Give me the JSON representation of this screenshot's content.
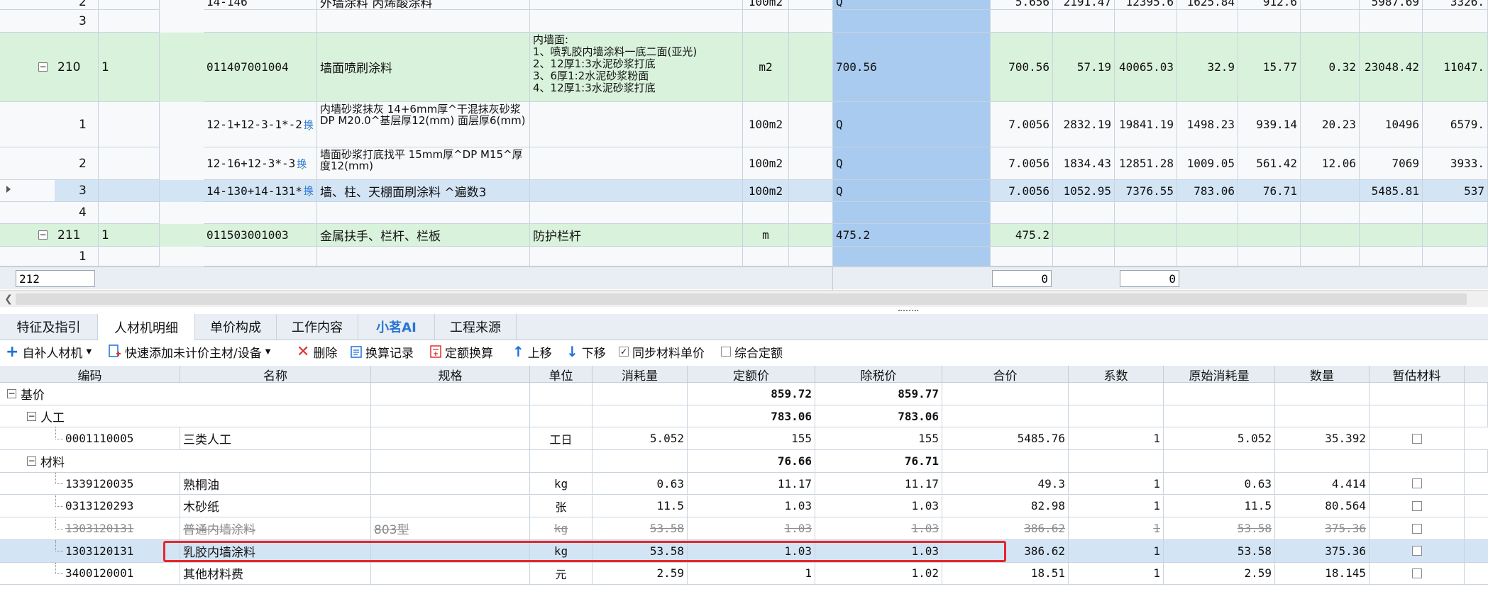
{
  "upper": {
    "rows": [
      {
        "seq": "2",
        "code": "14-146",
        "name": "外墙涂料 丙烯酸涂料",
        "unit": "100m2",
        "qty": "Q",
        "v1": "5.656",
        "v2": "2191.47",
        "v3": "12395.6",
        "v4": "1625.84",
        "v5": "912.6",
        "v6": "",
        "v7": "5987.69",
        "v8": "3326."
      },
      {
        "seq": "3"
      },
      {
        "id": "210",
        "seq": "1",
        "code": "011407001004",
        "name": "墙面喷刷涂料",
        "desc": "内墙面:\n1、喷乳胶内墙涂料一底二面(亚光)\n2、12厚1:3水泥砂浆打底\n3、6厚1:2水泥砂浆粉面\n4、12厚1:3水泥砂浆打底",
        "unit": "m2",
        "qty": "700.56",
        "v1": "700.56",
        "v2": "57.19",
        "v3": "40065.03",
        "v4": "32.9",
        "v5": "15.77",
        "v6": "0.32",
        "v7": "23048.42",
        "v8": "11047."
      },
      {
        "seq": "1",
        "code": "12-1+12-3-1*-2",
        "badge": "换",
        "name": "内墙砂浆抹灰 14+6mm厚^干混抹灰砂浆 DP M20.0^基层厚12(mm) 面层厚6(mm)",
        "unit": "100m2",
        "qty": "Q",
        "v1": "7.0056",
        "v2": "2832.19",
        "v3": "19841.19",
        "v4": "1498.23",
        "v5": "939.14",
        "v6": "20.23",
        "v7": "10496",
        "v8": "6579."
      },
      {
        "seq": "2",
        "code": "12-16+12-3*-3",
        "badge": "换",
        "name": "墙面砂浆打底找平 15mm厚^DP M15^厚度12(mm)",
        "unit": "100m2",
        "qty": "Q",
        "v1": "7.0056",
        "v2": "1834.43",
        "v3": "12851.28",
        "v4": "1009.05",
        "v5": "561.42",
        "v6": "12.06",
        "v7": "7069",
        "v8": "3933."
      },
      {
        "seq": "3",
        "code": "14-130+14-131*",
        "badge": "换",
        "name": "墙、柱、天棚面刷涂料 ^遍数3",
        "unit": "100m2",
        "qty": "Q",
        "v1": "7.0056",
        "v2": "1052.95",
        "v3": "7376.55",
        "v4": "783.06",
        "v5": "76.71",
        "v6": "",
        "v7": "5485.81",
        "v8": "537"
      },
      {
        "seq": "4"
      },
      {
        "id": "211",
        "seq": "1",
        "code": "011503001003",
        "name": "金属扶手、栏杆、栏板",
        "desc": "防护栏杆",
        "unit": "m",
        "qty": "475.2",
        "v1": "475.2"
      },
      {
        "seq": "1"
      }
    ],
    "footer": {
      "left": "212",
      "mid1": "0",
      "mid2": "0"
    }
  },
  "tabs": [
    "特征及指引",
    "人材机明细",
    "单价构成",
    "工作内容",
    "小茗AI",
    "工程来源"
  ],
  "active_tab": "人材机明细",
  "toolbar": {
    "add_label": "自补人材机",
    "quick_add_label": "快速添加未计价主材/设备",
    "delete_label": "删除",
    "calc_record_label": "换算记录",
    "quota_calc_label": "定额换算",
    "move_up_label": "上移",
    "move_down_label": "下移",
    "sync_price_label": "同步材料单价",
    "sync_price_checked": true,
    "combined_quota_label": "综合定额",
    "combined_quota_checked": false
  },
  "detail": {
    "columns": [
      "编码",
      "名称",
      "规格",
      "单位",
      "消耗量",
      "定额价",
      "除税价",
      "合价",
      "系数",
      "原始消耗量",
      "数量",
      "暂估材料"
    ],
    "groups": {
      "base": {
        "label": "基价",
        "quota_price": "859.72",
        "tax_free": "859.77"
      },
      "labor": {
        "label": "人工",
        "quota_price": "783.06",
        "tax_free": "783.06"
      },
      "material": {
        "label": "材料",
        "quota_price": "76.66",
        "tax_free": "76.71"
      }
    },
    "labor_rows": [
      {
        "code": "0001110005",
        "name": "三类人工",
        "spec": "",
        "unit": "工日",
        "consumption": "5.052",
        "quota_price": "155",
        "tax_free": "155",
        "total": "5485.76",
        "factor": "1",
        "orig": "5.052",
        "qty": "35.392"
      }
    ],
    "material_rows": [
      {
        "code": "1339120035",
        "name": "熟桐油",
        "spec": "",
        "unit": "kg",
        "consumption": "0.63",
        "quota_price": "11.17",
        "tax_free": "11.17",
        "total": "49.3",
        "factor": "1",
        "orig": "0.63",
        "qty": "4.414"
      },
      {
        "code": "0313120293",
        "name": "木砂纸",
        "spec": "",
        "unit": "张",
        "consumption": "11.5",
        "quota_price": "1.03",
        "tax_free": "1.03",
        "total": "82.98",
        "factor": "1",
        "orig": "11.5",
        "qty": "80.564"
      },
      {
        "code": "1303120131",
        "name": "普通内墙涂料",
        "spec": "803型",
        "unit": "kg",
        "consumption": "53.58",
        "quota_price": "1.03",
        "tax_free": "1.03",
        "total": "386.62",
        "factor": "1",
        "orig": "53.58",
        "qty": "375.36",
        "struck": true
      },
      {
        "code": "1303120131",
        "name": "乳胶内墙涂料",
        "spec": "",
        "unit": "kg",
        "consumption": "53.58",
        "quota_price": "1.03",
        "tax_free": "1.03",
        "total": "386.62",
        "factor": "1",
        "orig": "53.58",
        "qty": "375.36",
        "selected": true
      },
      {
        "code": "3400120001",
        "name": "其他材料费",
        "spec": "",
        "unit": "元",
        "consumption": "2.59",
        "quota_price": "1",
        "tax_free": "1.02",
        "total": "18.51",
        "factor": "1",
        "orig": "2.59",
        "qty": "18.145"
      }
    ]
  },
  "colors": {
    "green_row": "#d9f2dc",
    "selected_row": "#d3e4f5",
    "qty_col": "#a9cbef",
    "highlight_border": "#e8262a",
    "header_bg": "#e6ecf2"
  }
}
